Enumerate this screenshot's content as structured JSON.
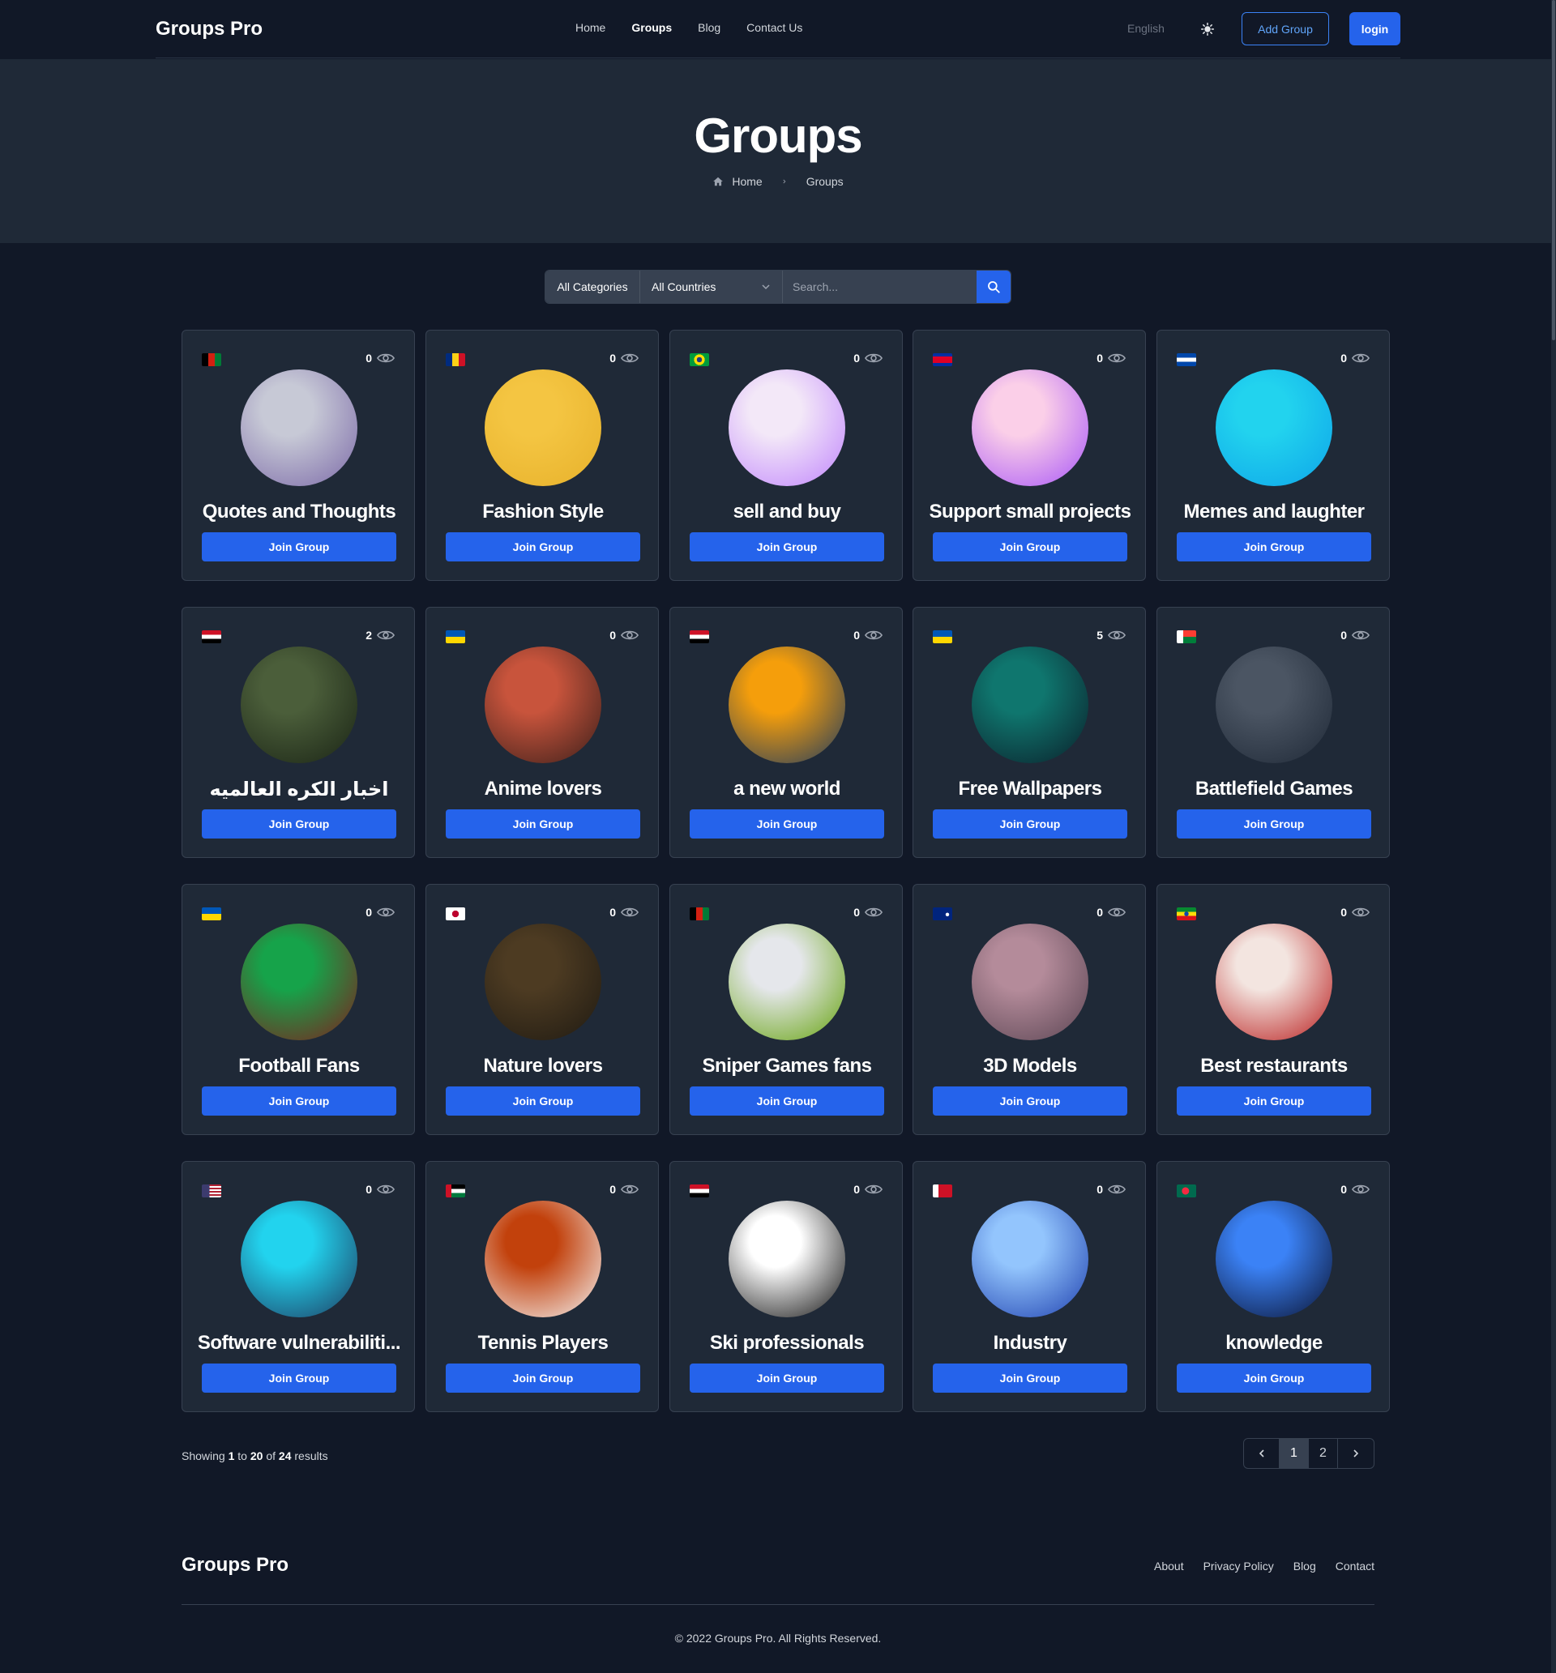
{
  "nav": {
    "brand": "Groups Pro",
    "menu": [
      {
        "label": "Home"
      },
      {
        "label": "Groups",
        "active": true
      },
      {
        "label": "Blog"
      },
      {
        "label": "Contact Us"
      }
    ],
    "language": "English",
    "theme_icon": "sun-icon",
    "add_group_label": "Add Group",
    "login_label": "login"
  },
  "hero": {
    "title": "Groups",
    "breadcrumb_home": "Home",
    "breadcrumb_current": "Groups"
  },
  "filters": {
    "category": "All Categories",
    "country": "All Countries",
    "search_placeholder": "Search..."
  },
  "join_label": "Join Group",
  "groups": [
    {
      "name": "Quotes and Thoughts",
      "views": "0",
      "flag": "afghanistan",
      "avatar_colors": [
        "#c7c9d6",
        "#7c6aa8"
      ]
    },
    {
      "name": "Fashion Style",
      "views": "0",
      "flag": "romania",
      "avatar_colors": [
        "#f4c542",
        "#e7b12b"
      ]
    },
    {
      "name": "sell and buy",
      "views": "0",
      "flag": "brazil",
      "avatar_colors": [
        "#f3e8f8",
        "#c084fc"
      ]
    },
    {
      "name": "Support small projects",
      "views": "0",
      "flag": "cambodia",
      "avatar_colors": [
        "#fbcfe8",
        "#a855f7"
      ]
    },
    {
      "name": "Memes and laughter",
      "views": "0",
      "flag": "el-salvador",
      "avatar_colors": [
        "#22d3ee",
        "#0ea5e9"
      ]
    },
    {
      "name": "اخبار الكره العالميه",
      "views": "2",
      "flag": "egypt",
      "avatar_colors": [
        "#4b5e3a",
        "#1a2415"
      ]
    },
    {
      "name": "Anime lovers",
      "views": "0",
      "flag": "ukraine",
      "avatar_colors": [
        "#c8543c",
        "#3b1f1a"
      ]
    },
    {
      "name": "a new world",
      "views": "0",
      "flag": "egypt",
      "avatar_colors": [
        "#f59e0b",
        "#1e3a5f"
      ]
    },
    {
      "name": "Free Wallpapers",
      "views": "5",
      "flag": "ukraine",
      "avatar_colors": [
        "#0f766e",
        "#0b1f2a"
      ]
    },
    {
      "name": "Battlefield Games",
      "views": "0",
      "flag": "madagascar",
      "avatar_colors": [
        "#4b5563",
        "#1f2937"
      ]
    },
    {
      "name": "Football Fans",
      "views": "0",
      "flag": "ukraine",
      "avatar_colors": [
        "#16a34a",
        "#7f1d1d"
      ]
    },
    {
      "name": "Nature lovers",
      "views": "0",
      "flag": "japan",
      "avatar_colors": [
        "#4d3b22",
        "#1f1a12"
      ]
    },
    {
      "name": "Sniper Games fans",
      "views": "0",
      "flag": "afghanistan",
      "avatar_colors": [
        "#e5e7eb",
        "#65a30d"
      ]
    },
    {
      "name": "3D Models",
      "views": "0",
      "flag": "new-zealand",
      "avatar_colors": [
        "#b48b9a",
        "#5b4553"
      ]
    },
    {
      "name": "Best restaurants",
      "views": "0",
      "flag": "ethiopia",
      "avatar_colors": [
        "#f3e5e0",
        "#b91c1c"
      ]
    },
    {
      "name": "Software vulnerabiliti...",
      "views": "0",
      "flag": "usa",
      "avatar_colors": [
        "#22d3ee",
        "#1e3a5f"
      ]
    },
    {
      "name": "Tennis Players",
      "views": "0",
      "flag": "jordan",
      "avatar_colors": [
        "#c2410c",
        "#f5f5f5"
      ]
    },
    {
      "name": "Ski professionals",
      "views": "0",
      "flag": "egypt",
      "avatar_colors": [
        "#ffffff",
        "#111111"
      ]
    },
    {
      "name": "Industry",
      "views": "0",
      "flag": "bahrain",
      "avatar_colors": [
        "#93c5fd",
        "#1e40af"
      ]
    },
    {
      "name": "knowledge",
      "views": "0",
      "flag": "bangladesh",
      "avatar_colors": [
        "#3b82f6",
        "#0a1230"
      ]
    }
  ],
  "pagination": {
    "showing_prefix": "Showing",
    "from": "1",
    "to_word": "to",
    "to": "20",
    "of_word": "of",
    "total": "24",
    "results_word": "results",
    "pages": [
      "1",
      "2"
    ],
    "current": "1"
  },
  "footer": {
    "brand": "Groups Pro",
    "links": [
      "About",
      "Privacy Policy",
      "Blog",
      "Contact"
    ],
    "copyright": "© 2022 Groups Pro. All Rights Reserved."
  }
}
